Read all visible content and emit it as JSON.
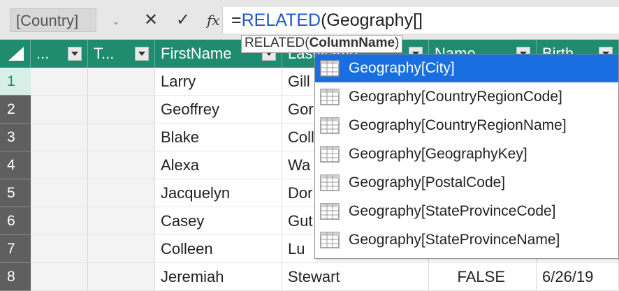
{
  "formula_bar": {
    "name_box": "[Country]",
    "dropdown_glyph": "⌄",
    "cancel_glyph": "✕",
    "commit_glyph": "✓",
    "fx_glyph": "fx",
    "formula_equals": "=",
    "formula_keyword": "RELATED",
    "formula_rest": "(Geography[]",
    "tooltip_prefix": "RELATED(",
    "tooltip_param": "ColumnName",
    "tooltip_suffix": ")"
  },
  "columns": [
    {
      "label": "..."
    },
    {
      "label": "T..."
    },
    {
      "label": "FirstName"
    },
    {
      "label": "LastName"
    },
    {
      "label": "Name"
    },
    {
      "label": "Birth"
    }
  ],
  "rows": [
    {
      "num": "1",
      "first": "Larry",
      "last": "Gill",
      "selected": true
    },
    {
      "num": "2",
      "first": "Geoffrey",
      "last": "Gor"
    },
    {
      "num": "3",
      "first": "Blake",
      "last": "Coll"
    },
    {
      "num": "4",
      "first": "Alexa",
      "last": "Wa"
    },
    {
      "num": "5",
      "first": "Jacquelyn",
      "last": "Dor"
    },
    {
      "num": "6",
      "first": "Casey",
      "last": "Gut"
    },
    {
      "num": "7",
      "first": "Colleen",
      "last": "Lu"
    },
    {
      "num": "8",
      "first": "Jeremiah",
      "last": "Stewart",
      "name": "FALSE",
      "birth": "6/26/19"
    }
  ],
  "autocomplete": {
    "items": [
      {
        "label": "Geography[City]",
        "active": true
      },
      {
        "label": "Geography[CountryRegionCode]"
      },
      {
        "label": "Geography[CountryRegionName]"
      },
      {
        "label": "Geography[GeographyKey]"
      },
      {
        "label": "Geography[PostalCode]"
      },
      {
        "label": "Geography[StateProvinceCode]"
      },
      {
        "label": "Geography[StateProvinceName]"
      }
    ],
    "item_icon": "table-column-icon"
  },
  "colors": {
    "header_bg": "#1f8b6f",
    "rownum_bg": "#5f5f5f",
    "autocomplete_active": "#1a6fe0",
    "keyword": "#1e56c9"
  }
}
